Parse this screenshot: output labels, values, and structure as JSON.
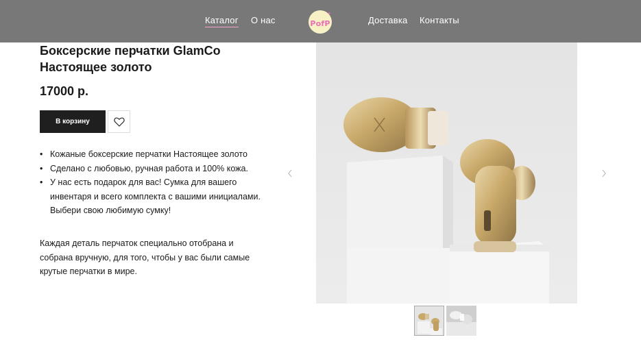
{
  "header": {
    "nav_left": [
      "Каталог",
      "О нас"
    ],
    "nav_right": [
      "Доставка",
      "Контакты"
    ],
    "logo_text": "PofP"
  },
  "product": {
    "title_line1": "Боксерские перчатки GlamCo",
    "title_line2": "Настоящее золото",
    "price": "17000 р.",
    "cart_label": "В корзину",
    "features": [
      "Кожаные боксерские перчатки Настоящее золото",
      "Сделано с любовью, ручная работа и 100% кожа.",
      "У нас есть подарок для вас! Сумка для вашего инвентаря и всего комплекта с вашими инициалами. Выбери свою любимую сумку!"
    ],
    "description": "Каждая деталь перчаток специально отобрана и собрана вручную, для того, чтобы у вас были самые крутые перчатки в мире."
  },
  "gallery": {
    "main_image": "gold-boxing-gloves-photo",
    "thumbnails": [
      "gold-gloves-thumb-1",
      "gold-gloves-thumb-2"
    ]
  },
  "colors": {
    "header_bg": "#787878",
    "accent_pink": "#f5a3c9",
    "button_dark": "#1f1f1f",
    "gold": "#c9a96a"
  }
}
